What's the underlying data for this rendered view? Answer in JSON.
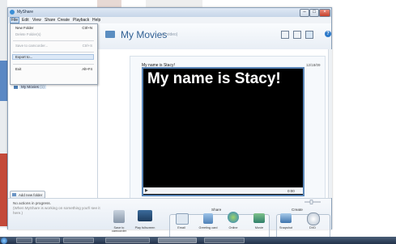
{
  "window": {
    "title": "MyShare"
  },
  "menubar": {
    "items": [
      "File",
      "Edit",
      "View",
      "Share",
      "Create",
      "Playback",
      "Help"
    ]
  },
  "file_menu": {
    "items": [
      {
        "label": "New Folder",
        "shortcut": "Ctrl+N",
        "disabled": false
      },
      {
        "label": "Delete Folder(s)",
        "shortcut": "",
        "disabled": true
      },
      {
        "label": "Save to camcorder...",
        "shortcut": "Ctrl+S",
        "disabled": true
      },
      {
        "label": "Export to...",
        "shortcut": "",
        "disabled": false
      },
      {
        "label": "Exit",
        "shortcut": "Alt+F4",
        "disabled": false
      }
    ]
  },
  "sidebar": {
    "items": [
      {
        "label": "December 2006",
        "count": "(1)"
      },
      {
        "label": "My Movies",
        "count": "(1)"
      }
    ],
    "add_folder_label": "Add new folder"
  },
  "header": {
    "title": "My Movies",
    "count": "(1 video)"
  },
  "video": {
    "label": "My name is Stacy!",
    "date": "12/18/09",
    "overlay_text": "My name is Stacy!",
    "time": "0:00"
  },
  "status": {
    "text": "No actions in progress.",
    "sub": "(When MyShare is working on something you'll see it here.)"
  },
  "toolbar": {
    "left_tools": [
      "Save to camcorder",
      "Play fullscreen"
    ],
    "share_label": "Share",
    "share_tools": [
      "Email",
      "Greeting card",
      "Online"
    ],
    "create_label": "Create",
    "create_tools": [
      "Movie",
      "Snapshot",
      "DVD"
    ]
  },
  "colors": {
    "accent": "#2f5f93",
    "video_border": "#5a86b8"
  },
  "taskbar": {
    "items": [
      "",
      "",
      "",
      "",
      "",
      ""
    ]
  }
}
